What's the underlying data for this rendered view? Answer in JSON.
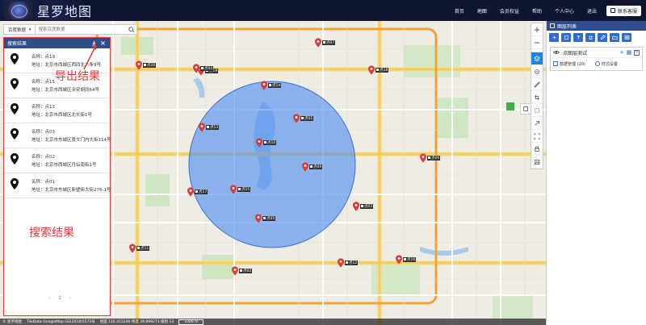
{
  "app": {
    "title": "星罗地图",
    "nav": [
      {
        "label": "首页",
        "active": false
      },
      {
        "label": "地图",
        "active": true
      },
      {
        "label": "会员权益",
        "active": false
      },
      {
        "label": "帮助",
        "active": false
      },
      {
        "label": "个人中心",
        "active": false
      },
      {
        "label": "退出",
        "active": false
      }
    ],
    "feedback_label": "联系客服"
  },
  "search": {
    "source": "百度数据",
    "placeholder": "搜索百度数据"
  },
  "results": {
    "title": "搜索结果",
    "items": [
      {
        "name": "名称：点19",
        "address": "地址：北京市西城区西四北八条9号"
      },
      {
        "name": "名称：点15",
        "address": "地址：北京市西城区永安胡同64号"
      },
      {
        "name": "名称：点13",
        "address": "地址：北京市西城区北长街1号"
      },
      {
        "name": "名称：点03",
        "address": "地址：北京市东城区景文门内大街114号"
      },
      {
        "name": "名称：点02",
        "address": "地址：北京市西城区月坛南街1号"
      },
      {
        "name": "名称：点01",
        "address": "地址：北京市东城区新壁街大街276-1号"
      }
    ],
    "pager": {
      "prev": "‹",
      "current": "1",
      "next": "›"
    }
  },
  "annotations": {
    "export": "导出结果",
    "search": "搜索结果"
  },
  "layers": {
    "title": "图层列表",
    "layer_name": "点图层测试",
    "data_mgmt": "数据管理 (20)",
    "style_settings": "样式设置"
  },
  "status": {
    "copyright": "© 星罗地图",
    "tiles": "TileData-GoogleMap-GS(2018)5572号",
    "coords": "经度 116.415246  纬度 39.899273  级别 13",
    "scale": "1000 m"
  },
  "markers": [
    {
      "label": "点19"
    },
    {
      "label": "点04"
    },
    {
      "label": "点14"
    },
    {
      "label": "点07"
    },
    {
      "label": "点18"
    },
    {
      "label": "点13"
    },
    {
      "label": "点01"
    },
    {
      "label": "点10"
    },
    {
      "label": "点09"
    },
    {
      "label": "点17"
    },
    {
      "label": "点15"
    },
    {
      "label": "点05"
    },
    {
      "label": "点08"
    },
    {
      "label": "点12"
    },
    {
      "label": "点06"
    },
    {
      "label": "点03"
    },
    {
      "label": "点11"
    },
    {
      "label": "点02"
    },
    {
      "label": "点16"
    },
    {
      "label": "点20"
    }
  ],
  "colors": {
    "topbar": "#0d1530",
    "panel_header": "#2e4d8c",
    "highlight": "#e03a3a",
    "circle": "#4d8cf0",
    "accent": "#1e86d9"
  }
}
